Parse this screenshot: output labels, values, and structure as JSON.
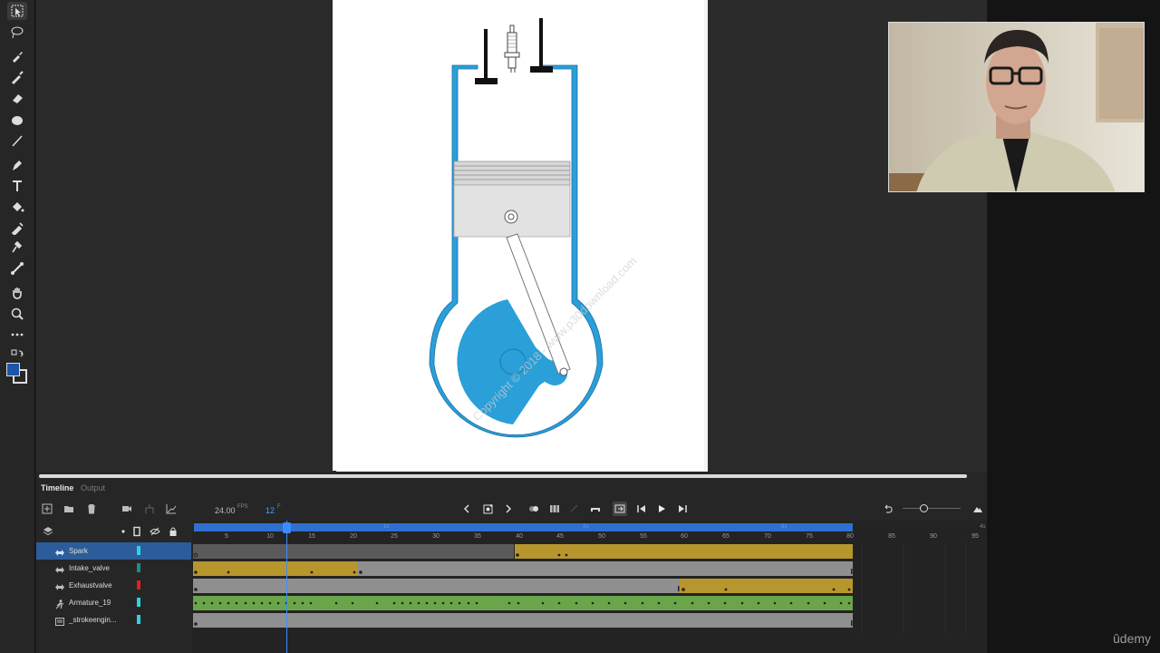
{
  "panel_tabs": {
    "timeline": "Timeline",
    "output": "Output"
  },
  "playback": {
    "fps_value": "24.00",
    "fps_unit": "FPS",
    "current_frame": "12",
    "frame_unit": "F"
  },
  "ruler": {
    "frame_ticks": [
      "5",
      "10",
      "15",
      "20",
      "25",
      "30",
      "35",
      "40",
      "45",
      "50",
      "55",
      "60",
      "65",
      "70",
      "75",
      "80",
      "85",
      "90",
      "95"
    ],
    "seconds": [
      "1s",
      "2s",
      "3s",
      "4s"
    ]
  },
  "layers": [
    {
      "name": "Spark",
      "color": "#2ad4e0",
      "selected": true,
      "icon": "motion-tween-layer-icon"
    },
    {
      "name": "Intake_valve",
      "color": "#1e8c8c",
      "selected": false,
      "icon": "motion-tween-layer-icon"
    },
    {
      "name": "Exhaustvalve",
      "color": "#e02020",
      "selected": false,
      "icon": "motion-tween-layer-icon"
    },
    {
      "name": "Armature_19",
      "color": "#2ad4e0",
      "selected": false,
      "icon": "armature-layer-icon"
    },
    {
      "name": "_strokeengin...",
      "color": "#2ad4e0",
      "selected": false,
      "icon": "normal-layer-icon"
    }
  ],
  "colors": {
    "tween": "#b8962e",
    "pose": "#6aa54a",
    "empty": "#8f8f8f",
    "accent": "#3d8bff",
    "engine_blue": "#2a9fd8"
  },
  "watermark": "Copyright © 2018 - www.p30download.com",
  "brand": "ûdemy"
}
